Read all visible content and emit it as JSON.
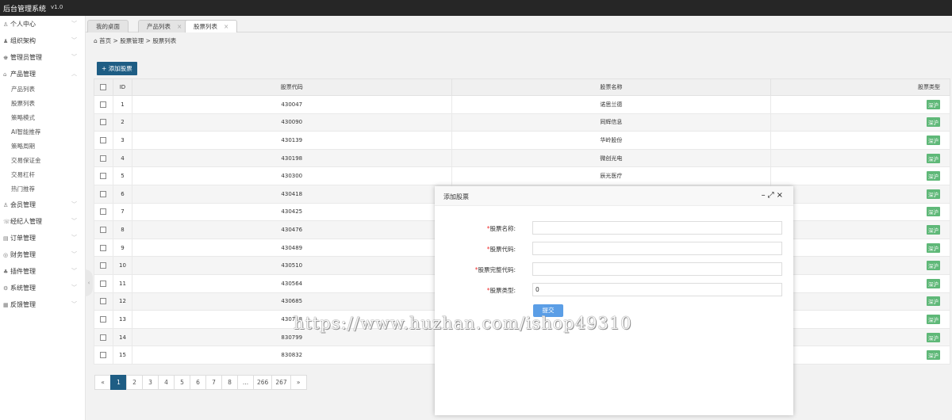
{
  "app": {
    "title": "后台管理系统",
    "version": "v1.0"
  },
  "sidebar": {
    "menus": [
      {
        "label": "个人中心",
        "icon": "user-icon"
      },
      {
        "label": "组织架构",
        "icon": "org-icon"
      },
      {
        "label": "管理员管理",
        "icon": "admin-icon"
      },
      {
        "label": "产品管理",
        "icon": "product-icon",
        "expanded": true,
        "children": [
          "产品列表",
          "股票列表",
          "策略模式",
          "AI智能推荐",
          "策略周期",
          "交易保证金",
          "交易杠杆",
          "热门推荐"
        ]
      },
      {
        "label": "会员管理",
        "icon": "member-icon"
      },
      {
        "label": "经纪人管理",
        "icon": "broker-icon"
      },
      {
        "label": "订单管理",
        "icon": "order-icon"
      },
      {
        "label": "财务管理",
        "icon": "finance-icon"
      },
      {
        "label": "插件管理",
        "icon": "plugin-icon"
      },
      {
        "label": "系统管理",
        "icon": "system-icon"
      },
      {
        "label": "反馈管理",
        "icon": "feedback-icon"
      }
    ]
  },
  "tabs": [
    {
      "label": "我的桌面",
      "closable": false
    },
    {
      "label": "产品列表",
      "closable": true
    },
    {
      "label": "股票列表",
      "closable": true,
      "active": true
    }
  ],
  "breadcrumb": {
    "home": "首页",
    "sep": ">",
    "level1": "股票管理",
    "level2": "股票列表"
  },
  "toolbar": {
    "add_label": "添加股票"
  },
  "table": {
    "headers": {
      "id": "ID",
      "code": "股票代码",
      "name": "股票名称",
      "type": "股票类型"
    },
    "rows": [
      {
        "id": "1",
        "code": "430047",
        "name": "诺思兰德",
        "type": "深沪"
      },
      {
        "id": "2",
        "code": "430090",
        "name": "同辉信息",
        "type": "深沪"
      },
      {
        "id": "3",
        "code": "430139",
        "name": "华岭股份",
        "type": "深沪"
      },
      {
        "id": "4",
        "code": "430198",
        "name": "微创光电",
        "type": "深沪"
      },
      {
        "id": "5",
        "code": "430300",
        "name": "辰光医疗",
        "type": "深沪"
      },
      {
        "id": "6",
        "code": "430418",
        "name": "",
        "type": "深沪"
      },
      {
        "id": "7",
        "code": "430425",
        "name": "",
        "type": "深沪"
      },
      {
        "id": "8",
        "code": "430476",
        "name": "",
        "type": "深沪"
      },
      {
        "id": "9",
        "code": "430489",
        "name": "",
        "type": "深沪"
      },
      {
        "id": "10",
        "code": "430510",
        "name": "",
        "type": "深沪"
      },
      {
        "id": "11",
        "code": "430564",
        "name": "",
        "type": "深沪"
      },
      {
        "id": "12",
        "code": "430685",
        "name": "",
        "type": "深沪"
      },
      {
        "id": "13",
        "code": "430718",
        "name": "",
        "type": "深沪"
      },
      {
        "id": "14",
        "code": "830799",
        "name": "",
        "type": "深沪"
      },
      {
        "id": "15",
        "code": "830832",
        "name": "",
        "type": "深沪"
      }
    ]
  },
  "pagination": {
    "prev": "«",
    "pages": [
      "1",
      "2",
      "3",
      "4",
      "5",
      "6",
      "7",
      "8",
      "...",
      "266",
      "267"
    ],
    "next": "»",
    "current": "1"
  },
  "modal": {
    "title": "添加股票",
    "fields": [
      {
        "label": "股票名称:",
        "value": ""
      },
      {
        "label": "股票代码:",
        "value": ""
      },
      {
        "label": "股票完整代码:",
        "value": ""
      },
      {
        "label": "股票类型:",
        "value": "0"
      }
    ],
    "required_mark": "*",
    "submit_label": "提交"
  },
  "watermark": "https://www.huzhan.com/ishop49310"
}
